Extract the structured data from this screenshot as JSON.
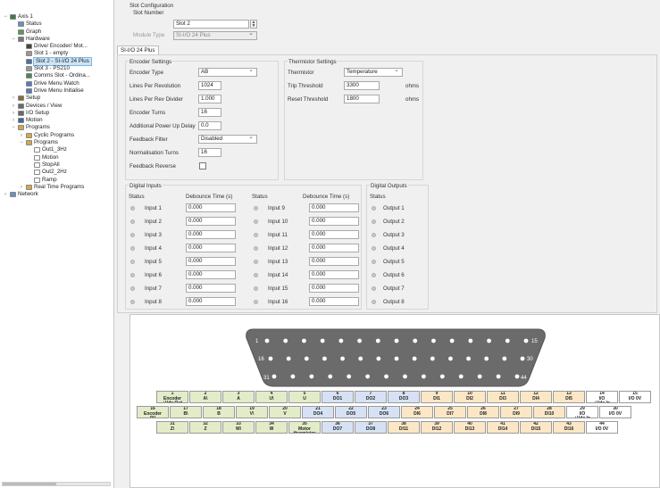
{
  "tree": {
    "items": [
      {
        "label": "Axis 1",
        "level": 0,
        "expand": "minus",
        "icon": "axis-icon",
        "color": "#3a7d3a"
      },
      {
        "label": "Status",
        "level": 1,
        "expand": "",
        "icon": "status-icon",
        "color": "#6a8fc8"
      },
      {
        "label": "Graph",
        "level": 1,
        "expand": "",
        "icon": "graph-icon",
        "color": "#5a9a5a"
      },
      {
        "label": "Hardware",
        "level": 1,
        "expand": "minus",
        "icon": "hardware-icon",
        "color": "#777777"
      },
      {
        "label": "Drive/ Encoder/ Mot...",
        "level": 2,
        "expand": "",
        "icon": "drive-icon",
        "color": "#444444"
      },
      {
        "label": "Slot 1 - empty",
        "level": 2,
        "expand": "",
        "icon": "slot-icon",
        "color": "#999999"
      },
      {
        "label": "Slot 2 - SI-I/O 24 Plus",
        "level": 2,
        "expand": "",
        "icon": "slot-icon",
        "color": "#4a6ea8",
        "selected": true
      },
      {
        "label": "Slot 3 - PS210",
        "level": 2,
        "expand": "",
        "icon": "slot-icon",
        "color": "#999999"
      },
      {
        "label": "Comms Slot - Ordina...",
        "level": 2,
        "expand": "",
        "icon": "comms-icon",
        "color": "#4a8a4a"
      },
      {
        "label": "Drive Menu Watch",
        "level": 2,
        "expand": "",
        "icon": "menu-watch-icon",
        "color": "#5a7ab8"
      },
      {
        "label": "Drive Menu Initialise",
        "level": 2,
        "expand": "",
        "icon": "menu-init-icon",
        "color": "#5a7ab8"
      },
      {
        "label": "Setup",
        "level": 1,
        "expand": "plus",
        "icon": "setup-icon",
        "color": "#8a6a3a"
      },
      {
        "label": "Devices / View",
        "level": 1,
        "expand": "plus",
        "icon": "devices-icon",
        "color": "#6a6a6a"
      },
      {
        "label": "I/O Setup",
        "level": 1,
        "expand": "plus",
        "icon": "io-icon",
        "color": "#6a6a6a"
      },
      {
        "label": "Motion",
        "level": 1,
        "expand": "plus",
        "icon": "motion-icon",
        "color": "#3a6a9a"
      },
      {
        "label": "Programs",
        "level": 1,
        "expand": "minus",
        "icon": "folder-icon",
        "color": "#d4a84a"
      },
      {
        "label": "Cyclic Programs",
        "level": 2,
        "expand": "plus",
        "icon": "folder-icon",
        "color": "#d4a84a"
      },
      {
        "label": "Programs",
        "level": 2,
        "expand": "minus",
        "icon": "folder-icon",
        "color": "#d4a84a"
      },
      {
        "label": "Out1_3Hz",
        "level": 3,
        "expand": "",
        "icon": "program-icon",
        "color": "#ffffff"
      },
      {
        "label": "Motion",
        "level": 3,
        "expand": "",
        "icon": "program-icon",
        "color": "#ffffff"
      },
      {
        "label": "StopAll",
        "level": 3,
        "expand": "",
        "icon": "program-icon",
        "color": "#ffffff"
      },
      {
        "label": "Out2_2Hz",
        "level": 3,
        "expand": "",
        "icon": "program-icon",
        "color": "#ffffff"
      },
      {
        "label": "Ramp",
        "level": 3,
        "expand": "",
        "icon": "program-icon",
        "color": "#ffffff"
      },
      {
        "label": "Real Time Programs",
        "level": 2,
        "expand": "plus",
        "icon": "folder-icon",
        "color": "#d4a84a"
      },
      {
        "label": "Network",
        "level": 0,
        "expand": "plus",
        "icon": "network-icon",
        "color": "#6a8fc8"
      }
    ]
  },
  "slot_config": {
    "heading": "Slot Configuration",
    "slot_number_label": "Slot Number",
    "slot_number_value": "Slot 2",
    "module_type_label": "Module Type",
    "module_type_value": "SI-I/O 24 Plus"
  },
  "tab_label": "SI-I/O 24 Plus",
  "encoder": {
    "title": "Encoder Settings",
    "fields": [
      {
        "label": "Encoder Type",
        "value": "AB",
        "kind": "dropdown"
      },
      {
        "label": "Lines Per Revolution",
        "value": "1024",
        "kind": "text"
      },
      {
        "label": "Lines Per Rev Divider",
        "value": "1.000",
        "kind": "text"
      },
      {
        "label": "Encoder Turns",
        "value": "16",
        "kind": "text"
      },
      {
        "label": "Additional Power Up Delay",
        "value": "0.0",
        "kind": "text"
      },
      {
        "label": "Feedback Filter",
        "value": "Disabled",
        "kind": "dropdown"
      },
      {
        "label": "Normalisation Turns",
        "value": "16",
        "kind": "text"
      },
      {
        "label": "Feedback Reverse",
        "value": "",
        "kind": "checkbox"
      }
    ]
  },
  "thermistor": {
    "title": "Thermistor Settings",
    "fields": [
      {
        "label": "Thermistor",
        "value": "Temperature",
        "kind": "dropdown",
        "unit": ""
      },
      {
        "label": "Trip Threshold",
        "value": "3300",
        "kind": "text",
        "unit": "ohms"
      },
      {
        "label": "Reset Threshold",
        "value": "1800",
        "kind": "text",
        "unit": "ohms"
      }
    ]
  },
  "digital_inputs": {
    "title": "Digital Inputs",
    "status_label": "Status",
    "debounce_label": "Debounce Time (s)",
    "left": [
      {
        "name": "Input 1",
        "value": "0.000"
      },
      {
        "name": "Input 2",
        "value": "0.000"
      },
      {
        "name": "Input 3",
        "value": "0.000"
      },
      {
        "name": "Input 4",
        "value": "0.000"
      },
      {
        "name": "Input 5",
        "value": "0.000"
      },
      {
        "name": "Input 6",
        "value": "0.000"
      },
      {
        "name": "Input 7",
        "value": "0.000"
      },
      {
        "name": "Input 8",
        "value": "0.000"
      }
    ],
    "right": [
      {
        "name": "Input 9",
        "value": "0.000"
      },
      {
        "name": "Input 10",
        "value": "0.000"
      },
      {
        "name": "Input 11",
        "value": "0.000"
      },
      {
        "name": "Input 12",
        "value": "0.000"
      },
      {
        "name": "Input 13",
        "value": "0.000"
      },
      {
        "name": "Input 14",
        "value": "0.000"
      },
      {
        "name": "Input 15",
        "value": "0.000"
      },
      {
        "name": "Input 16",
        "value": "0.000"
      }
    ]
  },
  "digital_outputs": {
    "title": "Digital Outputs",
    "status_label": "Status",
    "items": [
      "Output 1",
      "Output 2",
      "Output 3",
      "Output 4",
      "Output 5",
      "Output 6",
      "Output 7",
      "Output 8"
    ]
  },
  "connector": {
    "corner_labels": {
      "tl": "1",
      "tr": "15",
      "ml": "16",
      "mr": "30",
      "bl": "31",
      "br": "44"
    },
    "row1": [
      {
        "num": "1",
        "text": "Encoder\n+Vdc Out",
        "color": "green"
      },
      {
        "num": "2",
        "text": "A\\",
        "color": "green"
      },
      {
        "num": "3",
        "text": "A",
        "color": "green"
      },
      {
        "num": "4",
        "text": "U\\",
        "color": "green"
      },
      {
        "num": "5",
        "text": "U",
        "color": "green"
      },
      {
        "num": "6",
        "text": "DO1",
        "color": "blue"
      },
      {
        "num": "7",
        "text": "DO2",
        "color": "blue"
      },
      {
        "num": "8",
        "text": "DO3",
        "color": "blue"
      },
      {
        "num": "9",
        "text": "DI1",
        "color": "yellow"
      },
      {
        "num": "10",
        "text": "DI2",
        "color": "yellow"
      },
      {
        "num": "11",
        "text": "DI3",
        "color": "yellow"
      },
      {
        "num": "12",
        "text": "DI4",
        "color": "yellow"
      },
      {
        "num": "13",
        "text": "DI5",
        "color": "yellow"
      },
      {
        "num": "14",
        "text": "I/O\n+Vdc In",
        "color": "white"
      },
      {
        "num": "15",
        "text": "I/O 0V",
        "color": "white"
      }
    ],
    "row2": [
      {
        "num": "16",
        "text": "Encoder\n0V",
        "color": "green"
      },
      {
        "num": "17",
        "text": "B\\",
        "color": "green"
      },
      {
        "num": "18",
        "text": "B",
        "color": "green"
      },
      {
        "num": "19",
        "text": "V\\",
        "color": "green"
      },
      {
        "num": "20",
        "text": "V",
        "color": "green"
      },
      {
        "num": "21",
        "text": "DO4",
        "color": "blue"
      },
      {
        "num": "22",
        "text": "DO5",
        "color": "blue"
      },
      {
        "num": "23",
        "text": "DO6",
        "color": "blue"
      },
      {
        "num": "24",
        "text": "DI6",
        "color": "yellow"
      },
      {
        "num": "25",
        "text": "DI7",
        "color": "yellow"
      },
      {
        "num": "26",
        "text": "DI8",
        "color": "yellow"
      },
      {
        "num": "27",
        "text": "DI9",
        "color": "yellow"
      },
      {
        "num": "28",
        "text": "DI10",
        "color": "yellow"
      },
      {
        "num": "29",
        "text": "I/O\n+Vdc In",
        "color": "white"
      },
      {
        "num": "30",
        "text": "I/O 0V",
        "color": "white"
      }
    ],
    "row3": [
      {
        "num": "31",
        "text": "Z\\",
        "color": "green"
      },
      {
        "num": "32",
        "text": "Z",
        "color": "green"
      },
      {
        "num": "33",
        "text": "W\\",
        "color": "green"
      },
      {
        "num": "34",
        "text": "W",
        "color": "green"
      },
      {
        "num": "35",
        "text": "Motor\nthermistor",
        "color": "green"
      },
      {
        "num": "36",
        "text": "DO7",
        "color": "blue"
      },
      {
        "num": "37",
        "text": "DO8",
        "color": "blue"
      },
      {
        "num": "38",
        "text": "DI11",
        "color": "yellow"
      },
      {
        "num": "39",
        "text": "DI12",
        "color": "yellow"
      },
      {
        "num": "40",
        "text": "DI13",
        "color": "yellow"
      },
      {
        "num": "41",
        "text": "DI14",
        "color": "yellow"
      },
      {
        "num": "42",
        "text": "DI15",
        "color": "yellow"
      },
      {
        "num": "43",
        "text": "DI16",
        "color": "yellow"
      },
      {
        "num": "44",
        "text": "I/O 0V",
        "color": "white"
      }
    ]
  },
  "colors": {
    "selection": "#cde4f7",
    "green_cell": "#e3ecc8",
    "blue_cell": "#d6e2f4",
    "yellow_cell": "#fbe7c6",
    "connector_shell": "#6b6b6b"
  }
}
